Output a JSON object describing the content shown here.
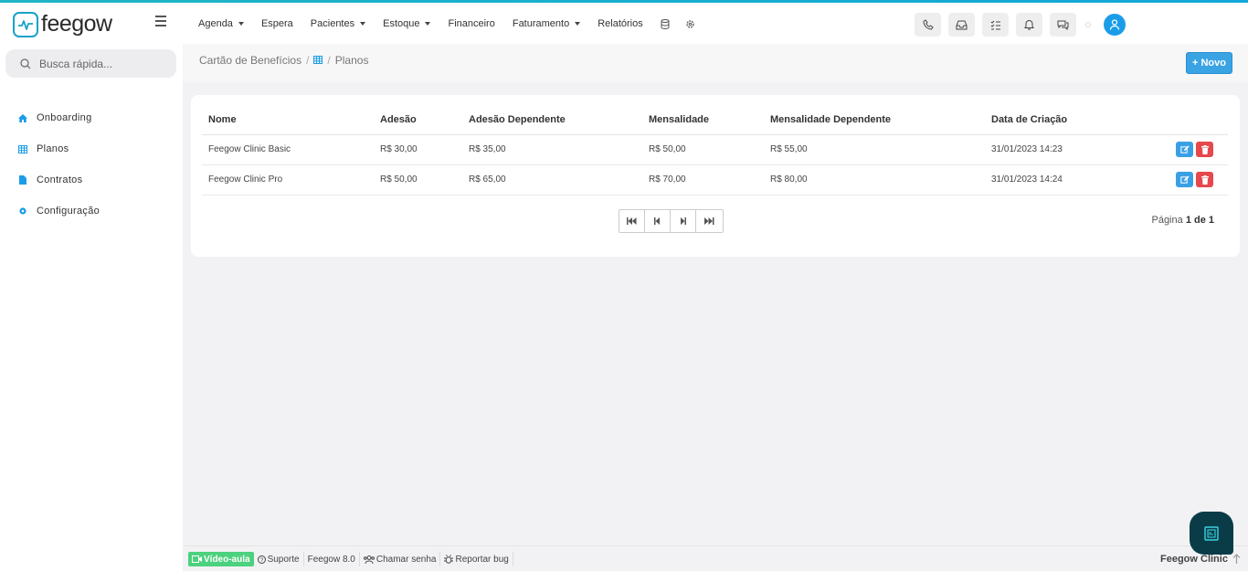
{
  "app": {
    "name": "feegow"
  },
  "nav": {
    "items": [
      {
        "label": "Agenda",
        "caret": true
      },
      {
        "label": "Espera",
        "caret": false
      },
      {
        "label": "Pacientes",
        "caret": true
      },
      {
        "label": "Estoque",
        "caret": true
      },
      {
        "label": "Financeiro",
        "caret": false
      },
      {
        "label": "Faturamento",
        "caret": true
      },
      {
        "label": "Relatórios",
        "caret": false
      }
    ]
  },
  "sidebar": {
    "search_placeholder": "Busca rápida...",
    "items": [
      {
        "label": "Onboarding",
        "icon": "home-icon"
      },
      {
        "label": "Planos",
        "icon": "table-icon"
      },
      {
        "label": "Contratos",
        "icon": "file-icon"
      },
      {
        "label": "Configuração",
        "icon": "gear-icon"
      }
    ]
  },
  "breadcrumb": {
    "root": "Cartão de Benefícios",
    "sep": "/",
    "current": "Planos"
  },
  "toolbar": {
    "new_label": "+ Novo"
  },
  "table": {
    "columns": [
      "Nome",
      "Adesão",
      "Adesão Dependente",
      "Mensalidade",
      "Mensalidade Dependente",
      "Data de Criação",
      ""
    ],
    "rows": [
      [
        "Feegow Clinic Basic",
        "R$ 30,00",
        "R$ 35,00",
        "R$ 50,00",
        "R$ 55,00",
        "31/01/2023 14:23"
      ],
      [
        "Feegow Clinic Pro",
        "R$ 50,00",
        "R$ 65,00",
        "R$ 70,00",
        "R$ 80,00",
        "31/01/2023 14:24"
      ]
    ]
  },
  "pagination": {
    "prefix": "Página",
    "current": "1 de 1"
  },
  "footer": {
    "video": "Vídeo-aula",
    "support": "Suporte",
    "version": "Feegow 8.0",
    "call": "Chamar senha",
    "bug": "Reportar bug",
    "right": "Feegow Clinic"
  },
  "colors": {
    "accent": "#1a9de8",
    "danger": "#e5484d",
    "success": "#4cd17e",
    "brand": "#18a2c8"
  }
}
